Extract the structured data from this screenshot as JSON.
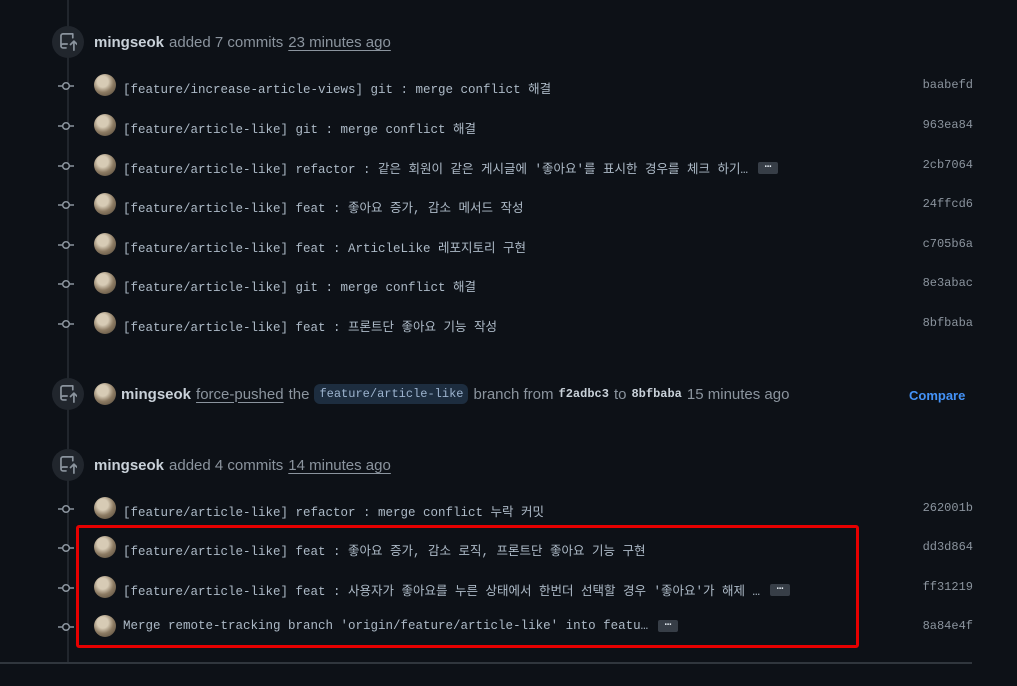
{
  "events": [
    {
      "actor": "mingseok",
      "action": "added 7 commits",
      "time": "23 minutes ago",
      "commits": [
        {
          "message": "[feature/increase-article-views] git : merge conflict 해결",
          "sha": "baabefd",
          "truncated": false
        },
        {
          "message": "[feature/article-like] git : merge conflict 해결",
          "sha": "963ea84",
          "truncated": false
        },
        {
          "message": "[feature/article-like] refactor : 같은 회원이 같은 게시글에 '좋아요'를 표시한 경우를 체크 하기…",
          "sha": "2cb7064",
          "truncated": true
        },
        {
          "message": "[feature/article-like] feat : 좋아요 증가, 감소 메서드 작성",
          "sha": "24ffcd6",
          "truncated": false
        },
        {
          "message": "[feature/article-like] feat : ArticleLike 레포지토리 구현",
          "sha": "c705b6a",
          "truncated": false
        },
        {
          "message": "[feature/article-like] git : merge conflict 해결",
          "sha": "8e3abac",
          "truncated": false
        },
        {
          "message": "[feature/article-like] feat : 프론트단 좋아요 기능 작성",
          "sha": "8bfbaba",
          "truncated": false
        }
      ]
    },
    {
      "actor": "mingseok",
      "action_link": "force-pushed",
      "the": "the",
      "branch": "feature/article-like",
      "branch_word": "branch from",
      "from_sha": "f2adbc3",
      "to_word": "to",
      "to_sha": "8bfbaba",
      "time": "15 minutes ago",
      "compare_label": "Compare"
    },
    {
      "actor": "mingseok",
      "action": "added 4 commits",
      "time": "14 minutes ago",
      "commits": [
        {
          "message": "[feature/article-like] refactor : merge conflict 누락 커밋",
          "sha": "262001b",
          "truncated": false
        },
        {
          "message": "[feature/article-like] feat : 좋아요 증가, 감소 로직, 프론트단 좋아요 기능 구현",
          "sha": "dd3d864",
          "truncated": false
        },
        {
          "message": "[feature/article-like] feat : 사용자가 좋아요를 누른 상태에서 한번더 선택할 경우 '좋아요'가 해제 …",
          "sha": "ff31219",
          "truncated": true
        },
        {
          "message": "Merge remote-tracking branch 'origin/feature/article-like' into featu…",
          "sha": "8a84e4f",
          "truncated": true
        }
      ]
    }
  ],
  "icons": {
    "event": "repo-push-icon",
    "commit": "git-commit-icon",
    "more": "ellipsis-icon"
  },
  "colors": {
    "background": "#0d1117",
    "accent": "#4493f8",
    "highlight": "#e60000"
  }
}
